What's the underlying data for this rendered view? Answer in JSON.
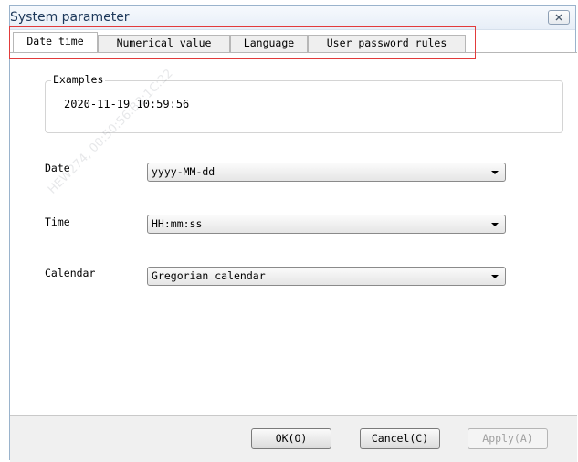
{
  "window": {
    "title": "System parameter"
  },
  "tabs": [
    {
      "label": "Date time",
      "active": true
    },
    {
      "label": "Numerical value",
      "active": false
    },
    {
      "label": "Language",
      "active": false
    },
    {
      "label": "User password rules",
      "active": false
    }
  ],
  "examples": {
    "legend": "Examples",
    "value": "2020-11-19 10:59:56"
  },
  "fields": {
    "date": {
      "label": "Date",
      "value": "yyyy-MM-dd"
    },
    "time": {
      "label": "Time",
      "value": "HH:mm:ss"
    },
    "calendar": {
      "label": "Calendar",
      "value": "Gregorian calendar"
    }
  },
  "buttons": {
    "ok": "OK(O)",
    "cancel": "Cancel(C)",
    "apply": "Apply(A)"
  },
  "watermark": "HEW274, 00:50:56:B3:1C:22",
  "colors": {
    "highlight": "#e23b3b",
    "title_text": "#1e395b"
  }
}
